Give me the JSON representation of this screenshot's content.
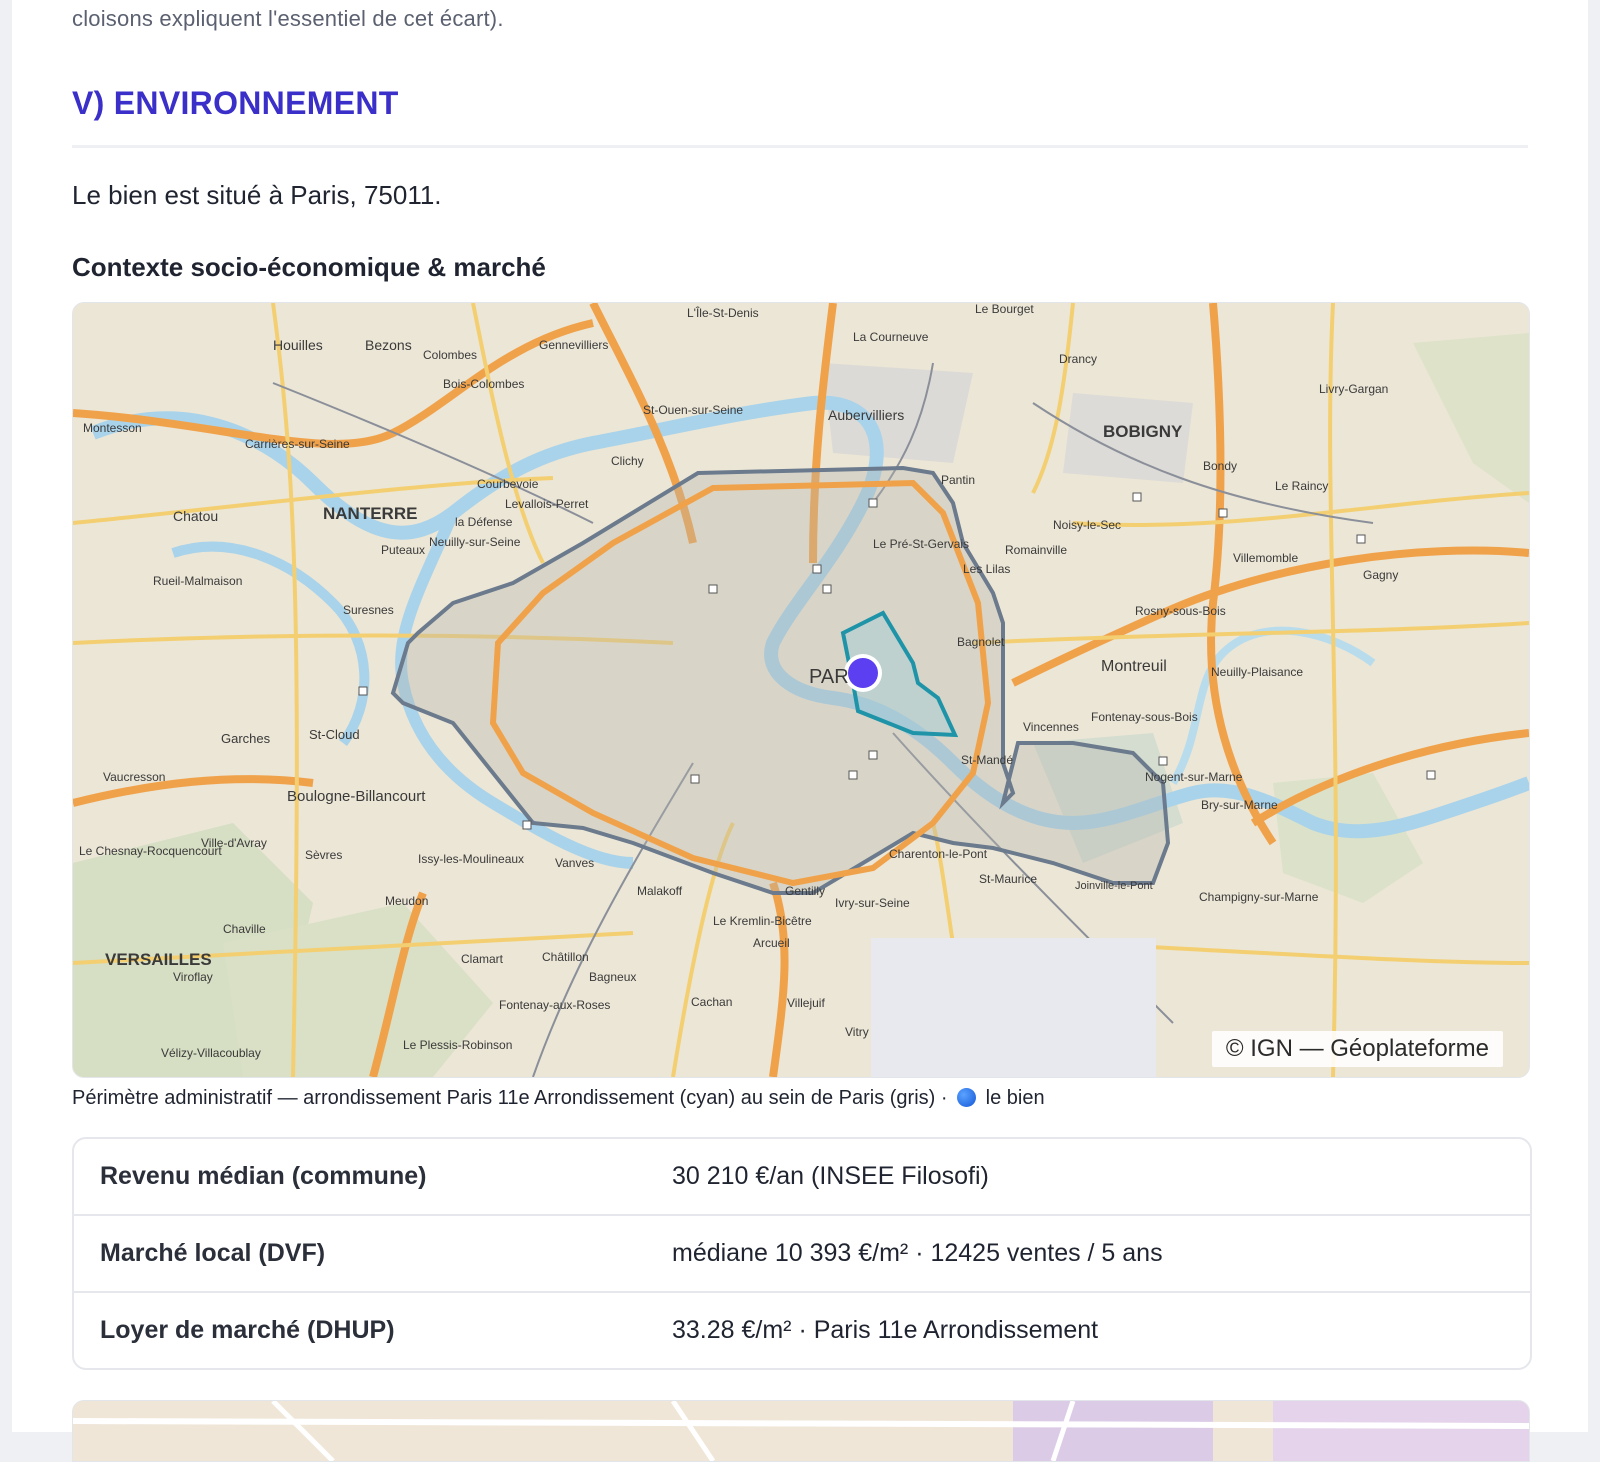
{
  "intro_tail": "cloisons expliquent l'essentiel de cet écart).",
  "section": {
    "heading": "V) ENVIRONNEMENT",
    "location_text": "Le bien est situé à Paris, 75011.",
    "subheading": "Contexte socio-économique & marché"
  },
  "map": {
    "attribution": "© IGN — Géoplateforme",
    "labels": {
      "paris": "PAR",
      "nanterre": "NANTERRE",
      "bobigny": "BOBIGNY",
      "versailles": "VERSAILLES",
      "montreuil": "Montreuil",
      "boulogne": "Boulogne-Billancourt",
      "aubervilliers": "Aubervilliers",
      "ile_st_denis": "L'Île-St-Denis",
      "la_courneuve": "La Courneuve",
      "le_bourget": "Le Bourget",
      "houilles": "Houilles",
      "bezons": "Bezons",
      "colombes": "Colombes",
      "gennevilliers": "Gennevilliers",
      "bois_colombes": "Bois-Colombes",
      "st_ouen": "St-Ouen-sur-Seine",
      "clichy": "Clichy",
      "pantin": "Pantin",
      "vincennes": "Vincennes",
      "st_mande": "St-Mandé",
      "charenton": "Charenton-le-Pont",
      "ivry": "Ivry-sur-Seine",
      "issy": "Issy-les-Moulineaux",
      "vanves": "Vanves",
      "malakoff": "Malakoff",
      "meudon": "Meudon",
      "clamart": "Clamart",
      "chatillon": "Châtillon",
      "bagneux": "Bagneux",
      "cachan": "Cachan",
      "villejuif": "Villejuif",
      "vitry": "Vitry",
      "suresnes": "Suresnes",
      "puteaux": "Puteaux",
      "courbevoie": "Courbevoie",
      "levallois": "Levallois-Perret",
      "la_defense": "la Défense",
      "neuilly": "Neuilly-sur-Seine",
      "chatou": "Chatou",
      "rueil": "Rueil-Malmaison",
      "garches": "Garches",
      "st_cloud": "St-Cloud",
      "sevres": "Sèvres",
      "bagnolet": "Bagnolet",
      "romainville": "Romainville",
      "les_lilas": "Les Lilas",
      "noisy_le_sec": "Noisy-le-Sec",
      "rosny": "Rosny-sous-Bois",
      "fontenay": "Fontenay-sous-Bois",
      "nogent": "Nogent-sur-Marne",
      "drancy": "Drancy",
      "bondy": "Bondy",
      "livry": "Livry-Gargan",
      "le_raincy": "Le Raincy",
      "villemomble": "Villemomble",
      "gagny": "Gagny",
      "neuilly_plaisance": "Neuilly-Plaisance",
      "le_pre_st_gervais": "Le Pré-St-Gervais",
      "gentilly": "Gentilly",
      "kremlin": "Le Kremlin-Bicêtre",
      "arcueil": "Arcueil",
      "st_maurice": "St-Maurice",
      "joinville": "Joinville-le-Pont",
      "champigny": "Champigny-sur-Marne",
      "bry": "Bry-sur-Marne",
      "montesson": "Montesson",
      "carrieres": "Carrières-sur-Seine",
      "velizy": "Vélizy-Villacoublay",
      "le_plessis_robinson": "Le Plessis-Robinson",
      "viroflay": "Viroflay",
      "chaville": "Chaville",
      "ville_davray": "Ville-d'Avray",
      "le_chesnay": "Le Chesnay-Rocquencourt",
      "vaucresson": "Vaucresson",
      "fontenay_roses": "Fontenay-aux-Roses"
    }
  },
  "caption": {
    "before": "Périmètre administratif — arrondissement Paris 11e Arrondissement (cyan) au sein de Paris (gris) ·",
    "after": "le bien"
  },
  "facts": [
    {
      "key": "Revenu médian (commune)",
      "value": "30 210 €/an (INSEE Filosofi)"
    },
    {
      "key": "Marché local (DVF)",
      "value": "médiane 10 393 €/m² · 12425 ventes / 5 ans"
    },
    {
      "key": "Loyer de marché (DHUP)",
      "value": "33.28 €/m² · Paris 11e Arrondissement"
    }
  ],
  "colors": {
    "accent": "#3a2fc8",
    "arrondissement_outline": "#1f94a8",
    "paris_outline": "#6b7a8c",
    "property_marker": "#5b3ff0"
  }
}
